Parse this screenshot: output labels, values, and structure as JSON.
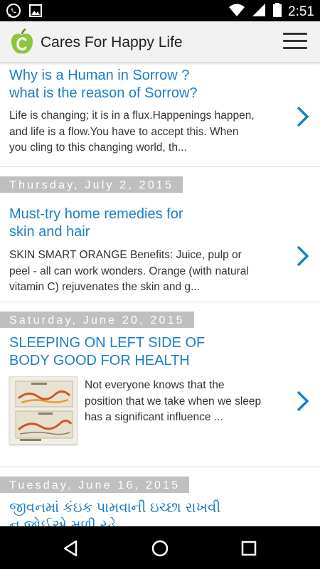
{
  "status_bar": {
    "time": "2:51",
    "left_icons": [
      "whatsapp-icon",
      "image-icon"
    ],
    "right_icons": [
      "wifi-icon",
      "cellular-signal-icon",
      "battery-icon"
    ]
  },
  "app_bar": {
    "title": "Cares For Happy Life",
    "logo_icon": "apple-logo-icon",
    "menu_icon": "hamburger-menu-icon"
  },
  "colors": {
    "accent": "#1a7fc6",
    "date_header_bg": "#bfbfbf",
    "logo_green": "#8cc63f",
    "app_bar_bg": "#f2f2f2"
  },
  "posts": [
    {
      "date": "",
      "title_line1": "Why is a Human in Sorrow ?",
      "title_line2": "what is the reason of Sorrow?",
      "excerpt_line1": "Life is changing; it is in a flux.Happenings happen,",
      "excerpt_line2": "and life is a flow.You have to accept this. When",
      "excerpt_line3": "you cling to this changing world, th..."
    },
    {
      "date": "Thursday, July 2, 2015",
      "title_line1": "Must-try home remedies for",
      "title_line2": "skin and hair",
      "excerpt_line1": "SKIN SMART   ORANGE Benefits:   Juice, pulp or",
      "excerpt_line2": "peel - all can work wonders. Orange (with natural",
      "excerpt_line3": "vitamin C) rejuvenates the skin and g..."
    },
    {
      "date": "Saturday, June 20, 2015",
      "title_line1": "SLEEPING ON LEFT SIDE OF",
      "title_line2": "BODY GOOD FOR HEALTH",
      "excerpt_line1": "Not everyone knows that the",
      "excerpt_line2": "position that we take when we sleep",
      "excerpt_line3": "has a significant influence ..."
    },
    {
      "date": "Tuesday, June 16, 2015",
      "title_line1": "જીવનમાં કંઇક પામવાની ઇચ્છા રાખવી",
      "title_line2": "ન જોઈએ મળી રહે"
    }
  ],
  "nav_bar": {
    "back_icon": "back-triangle-icon",
    "home_icon": "home-circle-icon",
    "recents_icon": "recents-square-icon"
  }
}
